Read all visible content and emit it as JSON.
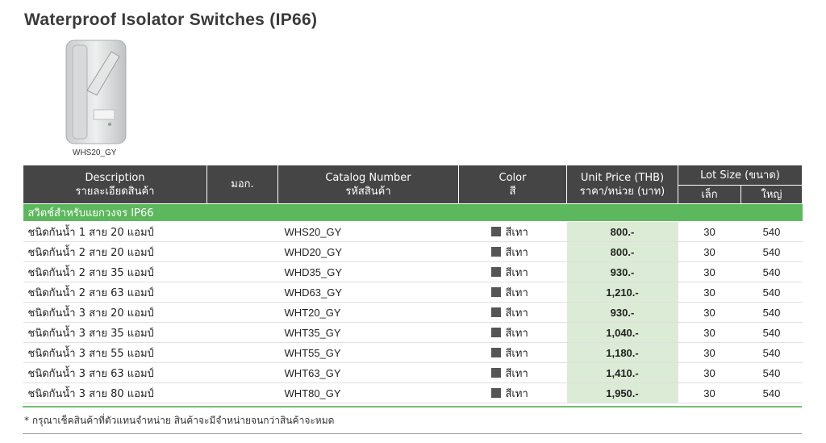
{
  "page": {
    "title": "Waterproof Isolator Switches (IP66)",
    "image_caption": "WHS20_GY",
    "footnote": "* กรุณาเช็คสินค้าที่ตัวแทนจำหน่าย สินค้าจะมีจำหน่ายจนกว่าสินค้าจะหมด"
  },
  "table": {
    "headers": {
      "description_en": "Description",
      "description_th": "รายละเอียดสินค้า",
      "tis": "มอก.",
      "catalog_en": "Catalog Number",
      "catalog_th": "รหัสสินค้า",
      "color_en": "Color",
      "color_th": "สี",
      "price_en": "Unit Price (THB)",
      "price_th": "ราคา/หน่วย (บาท)",
      "lot": "Lot Size (ขนาด)",
      "lot_small": "เล็ก",
      "lot_large": "ใหญ่"
    },
    "group_label": "สวิตช์สำหรับแยกวงจร IP66",
    "rows": [
      {
        "desc": "ชนิดกันน้ำ 1 สาย 20 แอมป์",
        "tis": "",
        "catalog": "WHS20_GY",
        "color": "สีเทา",
        "price": "800.-",
        "lot_small": "30",
        "lot_large": "540"
      },
      {
        "desc": "ชนิดกันน้ำ 2 สาย 20 แอมป์",
        "tis": "",
        "catalog": "WHD20_GY",
        "color": "สีเทา",
        "price": "800.-",
        "lot_small": "30",
        "lot_large": "540"
      },
      {
        "desc": "ชนิดกันน้ำ 2 สาย 35 แอมป์",
        "tis": "",
        "catalog": "WHD35_GY",
        "color": "สีเทา",
        "price": "930.-",
        "lot_small": "30",
        "lot_large": "540"
      },
      {
        "desc": "ชนิดกันน้ำ 2 สาย 63 แอมป์",
        "tis": "",
        "catalog": "WHD63_GY",
        "color": "สีเทา",
        "price": "1,210.-",
        "lot_small": "30",
        "lot_large": "540"
      },
      {
        "desc": "ชนิดกันน้ำ 3 สาย 20 แอมป์",
        "tis": "",
        "catalog": "WHT20_GY",
        "color": "สีเทา",
        "price": "930.-",
        "lot_small": "30",
        "lot_large": "540"
      },
      {
        "desc": "ชนิดกันน้ำ 3 สาย 35 แอมป์",
        "tis": "",
        "catalog": "WHT35_GY",
        "color": "สีเทา",
        "price": "1,040.-",
        "lot_small": "30",
        "lot_large": "540"
      },
      {
        "desc": "ชนิดกันน้ำ 3 สาย 55 แอมป์",
        "tis": "",
        "catalog": "WHT55_GY",
        "color": "สีเทา",
        "price": "1,180.-",
        "lot_small": "30",
        "lot_large": "540"
      },
      {
        "desc": "ชนิดกันน้ำ 3 สาย 63 แอมป์",
        "tis": "",
        "catalog": "WHT63_GY",
        "color": "สีเทา",
        "price": "1,410.-",
        "lot_small": "30",
        "lot_large": "540"
      },
      {
        "desc": "ชนิดกันน้ำ 3 สาย 80 แอมป์",
        "tis": "",
        "catalog": "WHT80_GY",
        "color": "สีเทา",
        "price": "1,950.-",
        "lot_small": "30",
        "lot_large": "540"
      }
    ]
  },
  "colors": {
    "header_bg": "#454545",
    "group_bg": "#5cb85c",
    "price_bg": "#dcebd5",
    "swatch_gray": "#555555"
  },
  "icons": {
    "product": "isolator-switch-photo",
    "color_swatch": "gray-square-swatch"
  }
}
